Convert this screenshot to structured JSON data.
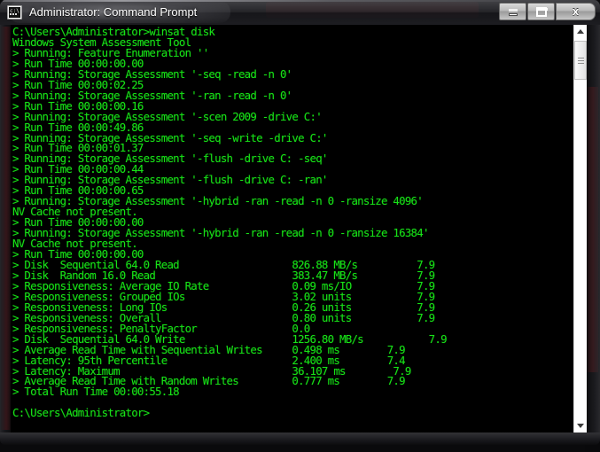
{
  "window": {
    "title": "Administrator: Command Prompt",
    "app_icon": "console-icon",
    "controls": {
      "minimize_label": "_",
      "maximize_label": "□",
      "close_label": "x"
    }
  },
  "colors": {
    "console_background": "#000000",
    "console_foreground": "#18e018",
    "accent_red": "#c3181c",
    "titlebar": "#26262a"
  },
  "scrollbar": {
    "up_arrow": "scroll-up-arrow",
    "down_arrow": "scroll-down-arrow",
    "thumb_position_percent": 4
  },
  "console": {
    "prompt": "C:\\Users\\Administrator>",
    "command": "winsat disk",
    "cursor": "_",
    "text": "C:\\Users\\Administrator>winsat disk\nWindows System Assessment Tool\n> Running: Feature Enumeration ''\n> Run Time 00:00:00.00\n> Running: Storage Assessment '-seq -read -n 0'\n> Run Time 00:00:02.25\n> Running: Storage Assessment '-ran -read -n 0'\n> Run Time 00:00:00.16\n> Running: Storage Assessment '-scen 2009 -drive C:'\n> Run Time 00:00:49.86\n> Running: Storage Assessment '-seq -write -drive C:'\n> Run Time 00:00:01.37\n> Running: Storage Assessment '-flush -drive C: -seq'\n> Run Time 00:00:00.44\n> Running: Storage Assessment '-flush -drive C: -ran'\n> Run Time 00:00:00.65\n> Running: Storage Assessment '-hybrid -ran -read -n 0 -ransize 4096'\nNV Cache not present.\n> Run Time 00:00:00.00\n> Running: Storage Assessment '-hybrid -ran -read -n 0 -ransize 16384'\nNV Cache not present.\n> Run Time 00:00:00.00\n> Disk  Sequential 64.0 Read                   826.88 MB/s          7.9\n> Disk  Random 16.0 Read                       383.47 MB/s          7.9\n> Responsiveness: Average IO Rate              0.09 ms/IO           7.9\n> Responsiveness: Grouped IOs                  3.02 units           7.9\n> Responsiveness: Long IOs                     0.26 units           7.9\n> Responsiveness: Overall                      0.80 units           7.9\n> Responsiveness: PenaltyFactor                0.0\n> Disk  Sequential 64.0 Write                  1256.80 MB/s           7.9\n> Average Read Time with Sequential Writes     0.498 ms        7.9\n> Latency: 95th Percentile                     2.400 ms        7.4\n> Latency: Maximum                             36.107 ms        7.9\n> Average Read Time with Random Writes         0.777 ms        7.9\n> Total Run Time 00:00:55.18\n\nC:\\Users\\Administrator>",
    "lines": [
      "C:\\Users\\Administrator>winsat disk",
      "Windows System Assessment Tool",
      "> Running: Feature Enumeration ''",
      "> Run Time 00:00:00.00",
      "> Running: Storage Assessment '-seq -read -n 0'",
      "> Run Time 00:00:02.25",
      "> Running: Storage Assessment '-ran -read -n 0'",
      "> Run Time 00:00:00.16",
      "> Running: Storage Assessment '-scen 2009 -drive C:'",
      "> Run Time 00:00:49.86",
      "> Running: Storage Assessment '-seq -write -drive C:'",
      "> Run Time 00:00:01.37",
      "> Running: Storage Assessment '-flush -drive C: -seq'",
      "> Run Time 00:00:00.44",
      "> Running: Storage Assessment '-flush -drive C: -ran'",
      "> Run Time 00:00:00.65",
      "> Running: Storage Assessment '-hybrid -ran -read -n 0 -ransize 4096'",
      "NV Cache not present.",
      "> Run Time 00:00:00.00",
      "> Running: Storage Assessment '-hybrid -ran -read -n 0 -ransize 16384'",
      "NV Cache not present.",
      "> Run Time 00:00:00.00",
      "> Disk  Sequential 64.0 Read                   826.88 MB/s          7.9",
      "> Disk  Random 16.0 Read                       383.47 MB/s          7.9",
      "> Responsiveness: Average IO Rate              0.09 ms/IO           7.9",
      "> Responsiveness: Grouped IOs                  3.02 units           7.9",
      "> Responsiveness: Long IOs                     0.26 units           7.9",
      "> Responsiveness: Overall                      0.80 units           7.9",
      "> Responsiveness: PenaltyFactor                0.0",
      "> Disk  Sequential 64.0 Write                  1256.80 MB/s           7.9",
      "> Average Read Time with Sequential Writes     0.498 ms        7.9",
      "> Latency: 95th Percentile                     2.400 ms        7.4",
      "> Latency: Maximum                             36.107 ms        7.9",
      "> Average Read Time with Random Writes         0.777 ms        7.9",
      "> Total Run Time 00:00:55.18",
      "",
      "C:\\Users\\Administrator>"
    ],
    "results": [
      {
        "metric": "Disk  Sequential 64.0 Read",
        "value": "826.88",
        "unit": "MB/s",
        "score": "7.9"
      },
      {
        "metric": "Disk  Random 16.0 Read",
        "value": "383.47",
        "unit": "MB/s",
        "score": "7.9"
      },
      {
        "metric": "Responsiveness: Average IO Rate",
        "value": "0.09",
        "unit": "ms/IO",
        "score": "7.9"
      },
      {
        "metric": "Responsiveness: Grouped IOs",
        "value": "3.02",
        "unit": "units",
        "score": "7.9"
      },
      {
        "metric": "Responsiveness: Long IOs",
        "value": "0.26",
        "unit": "units",
        "score": "7.9"
      },
      {
        "metric": "Responsiveness: Overall",
        "value": "0.80",
        "unit": "units",
        "score": "7.9"
      },
      {
        "metric": "Responsiveness: PenaltyFactor",
        "value": "0.0",
        "unit": "",
        "score": ""
      },
      {
        "metric": "Disk  Sequential 64.0 Write",
        "value": "1256.80",
        "unit": "MB/s",
        "score": "7.9"
      },
      {
        "metric": "Average Read Time with Sequential Writes",
        "value": "0.498",
        "unit": "ms",
        "score": "7.9"
      },
      {
        "metric": "Latency: 95th Percentile",
        "value": "2.400",
        "unit": "ms",
        "score": "7.4"
      },
      {
        "metric": "Latency: Maximum",
        "value": "36.107",
        "unit": "ms",
        "score": "7.9"
      },
      {
        "metric": "Average Read Time with Random Writes",
        "value": "0.777",
        "unit": "ms",
        "score": "7.9"
      }
    ],
    "total_run_time": "00:00:55.18"
  }
}
